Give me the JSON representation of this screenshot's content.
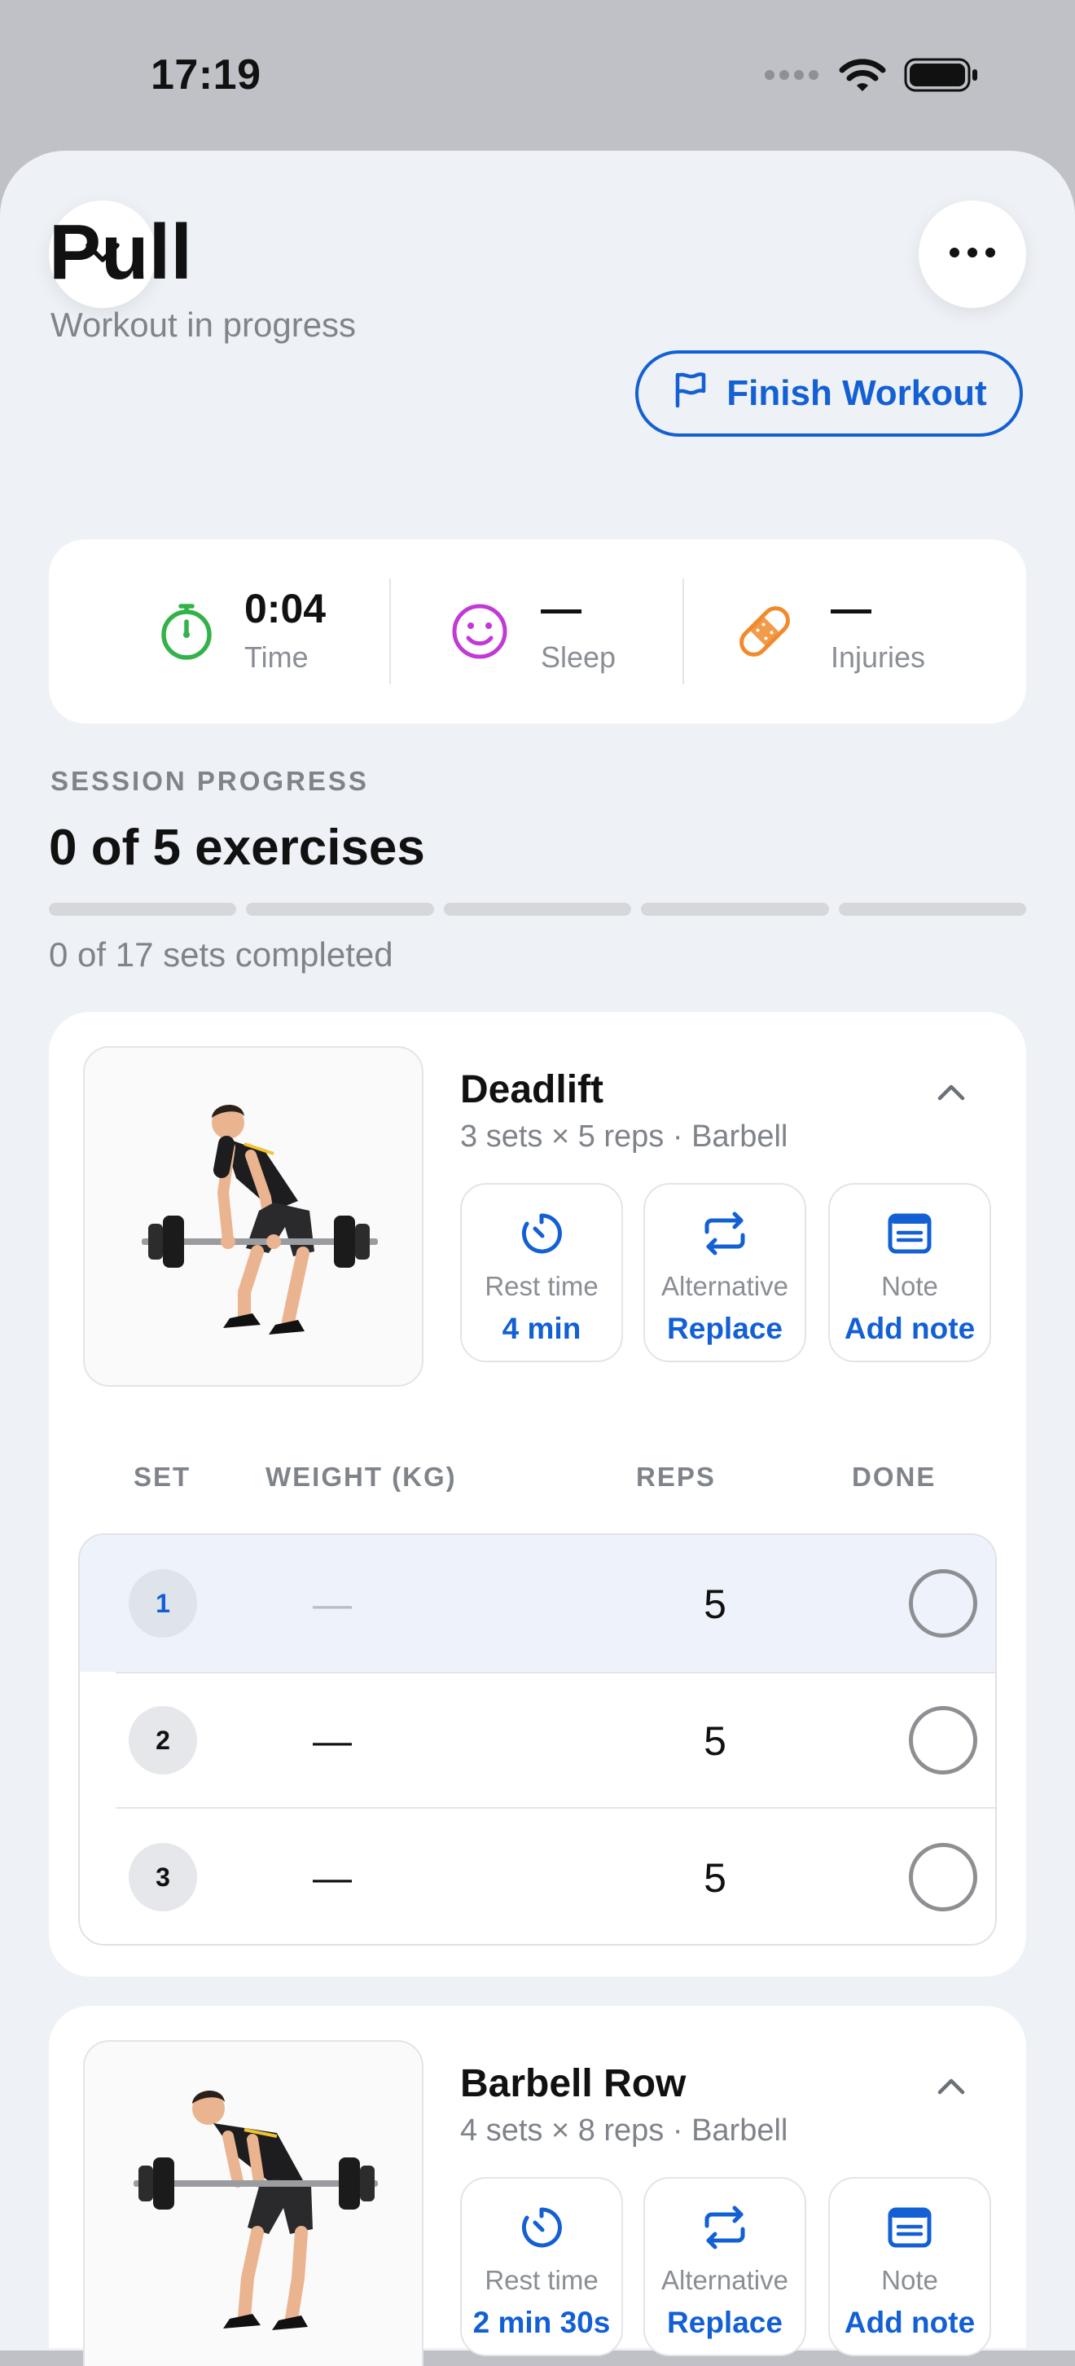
{
  "status_bar": {
    "time": "17:19"
  },
  "header": {
    "title": "Pull",
    "subtitle": "Workout in progress",
    "finish_label": "Finish Workout"
  },
  "stats": [
    {
      "value": "0:04",
      "label": "Time",
      "icon": "stopwatch-icon",
      "color": "#34b24a"
    },
    {
      "value": "—",
      "label": "Sleep",
      "icon": "smiley-face-icon",
      "color": "#c13ad6"
    },
    {
      "value": "—",
      "label": "Injuries",
      "icon": "bandage-icon",
      "color": "#f08a2b"
    }
  ],
  "progress": {
    "section_label": "SESSION PROGRESS",
    "title": "0 of 5 exercises",
    "completed_exercises": 0,
    "total_exercises": 5,
    "sets_text": "0 of 17 sets completed"
  },
  "colors": {
    "accent": "#1360d4",
    "background": "#eef1f6",
    "card": "#ffffff"
  },
  "exercises": [
    {
      "name": "Deadlift",
      "meta": "3 sets × 5 reps · Barbell",
      "expanded": true,
      "rest": {
        "label": "Rest time",
        "value": "4 min"
      },
      "alternative": {
        "label": "Alternative",
        "value": "Replace"
      },
      "note": {
        "label": "Note",
        "value": "Add note"
      },
      "columns": {
        "set": "SET",
        "weight": "WEIGHT (KG)",
        "reps": "REPS",
        "done": "DONE"
      },
      "sets": [
        {
          "num": "1",
          "weight": "—",
          "reps": "5",
          "done": false,
          "active": true
        },
        {
          "num": "2",
          "weight": "—",
          "reps": "5",
          "done": false,
          "active": false
        },
        {
          "num": "3",
          "weight": "—",
          "reps": "5",
          "done": false,
          "active": false
        }
      ]
    },
    {
      "name": "Barbell Row",
      "meta": "4 sets × 8 reps · Barbell",
      "expanded": true,
      "rest": {
        "label": "Rest time",
        "value": "2 min 30s"
      },
      "alternative": {
        "label": "Alternative",
        "value": "Replace"
      },
      "note": {
        "label": "Note",
        "value": "Add note"
      }
    }
  ]
}
